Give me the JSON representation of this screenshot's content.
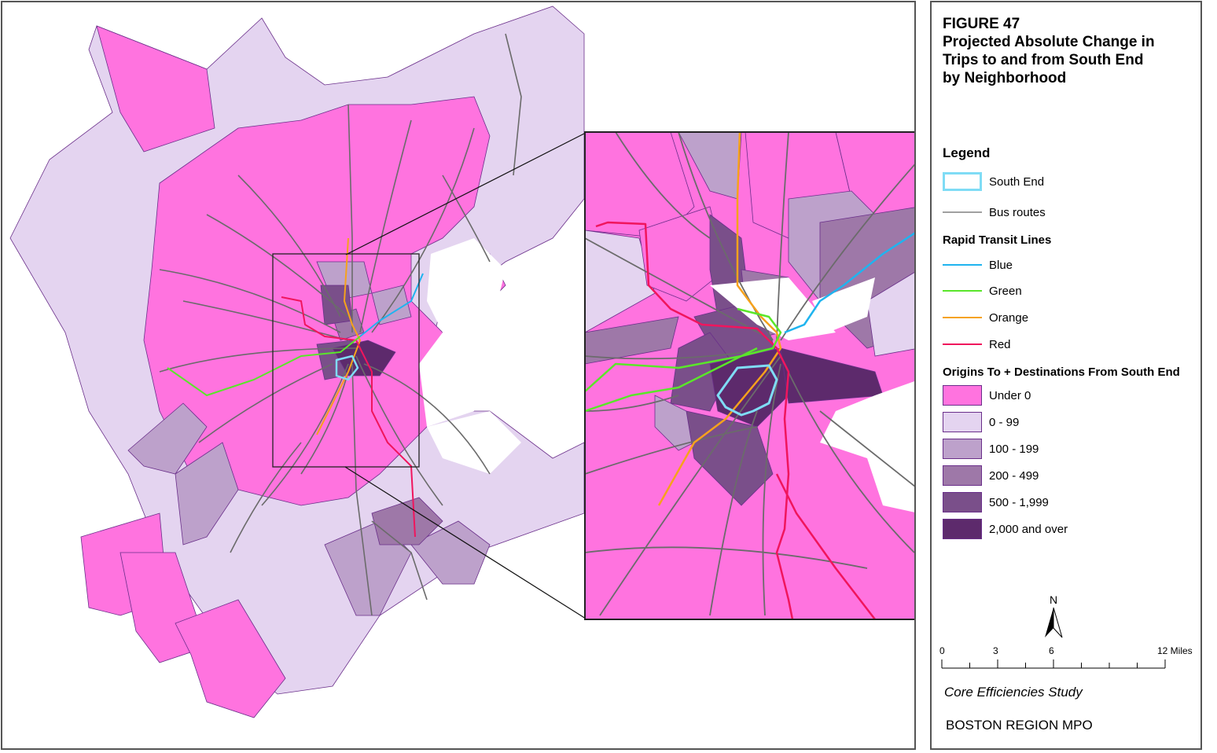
{
  "figure": {
    "number": "FIGURE 47",
    "title_lines": [
      "Projected Absolute Change in",
      "Trips to and from South End",
      "by Neighborhood"
    ]
  },
  "legend": {
    "heading": "Legend",
    "south_end": {
      "label": "South End",
      "color": "#7fdcf5"
    },
    "bus_routes": {
      "label": "Bus routes",
      "color": "#a0a0a0"
    },
    "rapid_transit_heading": "Rapid Transit Lines",
    "rapid_transit": [
      {
        "label": "Blue",
        "color": "#1fb4ef"
      },
      {
        "label": "Green",
        "color": "#5ae62a"
      },
      {
        "label": "Orange",
        "color": "#f6a21c"
      },
      {
        "label": "Red",
        "color": "#f0155d"
      }
    ],
    "classes_heading": "Origins To + Destinations From South End",
    "classes": [
      {
        "label": "Under 0",
        "color": "#ff73df"
      },
      {
        "label": "0 - 99",
        "color": "#e4d4f0"
      },
      {
        "label": "100 - 199",
        "color": "#bda1cb"
      },
      {
        "label": "200 - 499",
        "color": "#9e78a8"
      },
      {
        "label": "500 - 1,999",
        "color": "#7a4f8a"
      },
      {
        "label": "2,000 and over",
        "color": "#5d2a6c"
      }
    ]
  },
  "north_arrow": {
    "label": "N"
  },
  "scale_bar": {
    "ticks": [
      "0",
      "3",
      "6",
      "12 Miles"
    ]
  },
  "credit": "Core Efficiencies Study",
  "organization": "BOSTON REGION MPO",
  "map_colors": {
    "boundary": "#6a2f8a",
    "bus": "#6b6b6b",
    "frame": "#222222"
  }
}
